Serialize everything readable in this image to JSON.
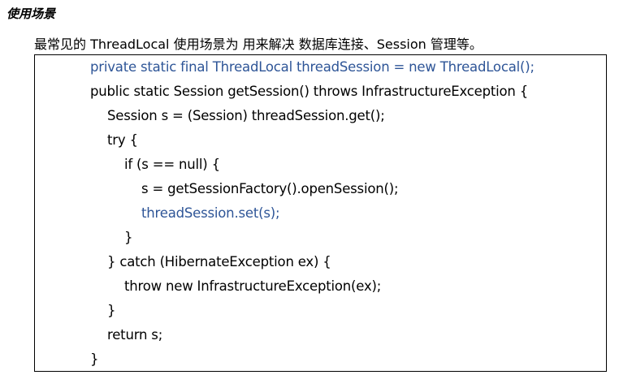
{
  "heading": "使用场景",
  "intro": "最常见的 ThreadLocal 使用场景为 用来解决 数据库连接、Session 管理等。",
  "code": [
    {
      "text": "private static final ThreadLocal threadSession = new ThreadLocal();",
      "indent": 0,
      "highlight": true
    },
    {
      "text": "public static Session getSession() throws InfrastructureException {",
      "indent": 0,
      "highlight": false
    },
    {
      "text": "Session s = (Session) threadSession.get();",
      "indent": 1,
      "highlight": false
    },
    {
      "text": "try {",
      "indent": 1,
      "highlight": false
    },
    {
      "text": "if (s == null) {",
      "indent": 2,
      "highlight": false
    },
    {
      "text": "s = getSessionFactory().openSession();",
      "indent": 3,
      "highlight": false
    },
    {
      "text": "threadSession.set(s);",
      "indent": 3,
      "highlight": true
    },
    {
      "text": "}",
      "indent": 2,
      "highlight": false
    },
    {
      "text": "} catch (HibernateException ex) {",
      "indent": 1,
      "highlight": false
    },
    {
      "text": "throw new InfrastructureException(ex);",
      "indent": 2,
      "highlight": false
    },
    {
      "text": "}",
      "indent": 1,
      "highlight": false
    },
    {
      "text": "return s;",
      "indent": 1,
      "highlight": false
    },
    {
      "text": "}",
      "indent": 0,
      "highlight": false
    }
  ],
  "colors": {
    "highlight": "#2e5597"
  }
}
